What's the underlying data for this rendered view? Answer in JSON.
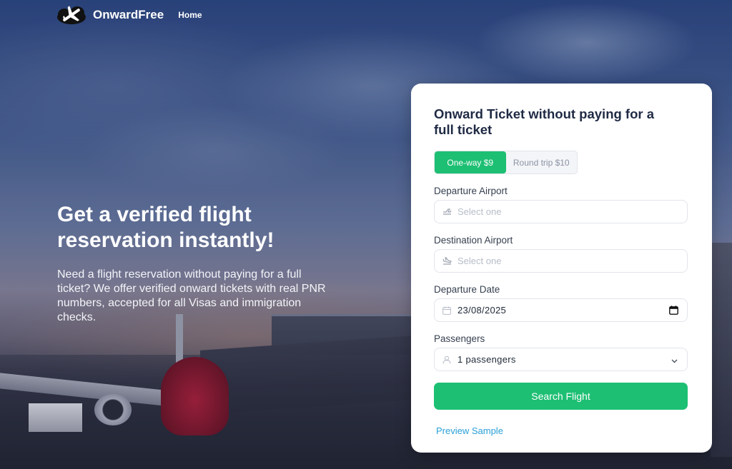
{
  "header": {
    "brand": "OnwardFree",
    "nav_home": "Home"
  },
  "hero": {
    "title": "Get a verified flight reservation instantly!",
    "description": "Need a flight reservation without paying for a full ticket? We offer verified onward tickets with real PNR numbers, accepted for all Visas and immigration checks."
  },
  "form": {
    "title": "Onward Ticket without paying for a full ticket",
    "trip_options": [
      {
        "label": "One-way $9",
        "active": true
      },
      {
        "label": "Round trip $10",
        "active": false
      }
    ],
    "departure_airport": {
      "label": "Departure Airport",
      "placeholder": "Select one",
      "icon": "plane-takeoff-icon"
    },
    "destination_airport": {
      "label": "Destination Airport",
      "placeholder": "Select one",
      "icon": "plane-landing-icon"
    },
    "departure_date": {
      "label": "Departure Date",
      "value": "23/08/2025",
      "icon": "calendar-icon"
    },
    "passengers": {
      "label": "Passengers",
      "value": "1 passengers",
      "icon": "user-icon"
    },
    "search_button": "Search Flight",
    "preview_link": "Preview Sample"
  },
  "colors": {
    "accent": "#1dbf73",
    "link": "#2a9fd8",
    "title": "#1f2a44"
  }
}
